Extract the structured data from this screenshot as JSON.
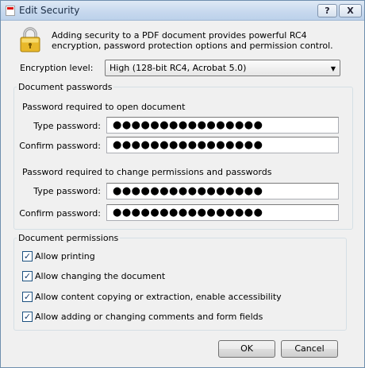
{
  "window": {
    "title": "Edit Security",
    "help_label": "?",
    "close_label": "X"
  },
  "intro_text": "Adding security to a PDF document provides powerful RC4 encryption, password protection options and permission control.",
  "encryption": {
    "label": "Encryption level:",
    "selected": "High (128-bit RC4, Acrobat 5.0)"
  },
  "passwords_group": {
    "legend": "Document passwords",
    "open_heading": "Password required to open document",
    "open_type_label": "Type password:",
    "open_type_value": "●●●●●●●●●●●●●●●●",
    "open_confirm_label": "Confirm password:",
    "open_confirm_value": "●●●●●●●●●●●●●●●●",
    "perm_heading": "Password required to change permissions and passwords",
    "perm_type_label": "Type password:",
    "perm_type_value": "●●●●●●●●●●●●●●●●",
    "perm_confirm_label": "Confirm password:",
    "perm_confirm_value": "●●●●●●●●●●●●●●●●"
  },
  "permissions_group": {
    "legend": "Document permissions",
    "items": [
      {
        "label": "Allow printing",
        "checked": true
      },
      {
        "label": "Allow changing the document",
        "checked": true
      },
      {
        "label": "Allow content copying or extraction, enable accessibility",
        "checked": true
      },
      {
        "label": "Allow adding or changing comments and form fields",
        "checked": true
      }
    ]
  },
  "buttons": {
    "ok": "OK",
    "cancel": "Cancel"
  },
  "icons": {
    "title": "pdf-document-icon",
    "lock": "padlock-icon",
    "dropdown": "chevron-down-icon",
    "check": "checkmark-icon"
  },
  "colors": {
    "window_bg": "#f0f0f0",
    "titlebar": "#c6d8ee",
    "lock_gold": "#e8b82a"
  }
}
